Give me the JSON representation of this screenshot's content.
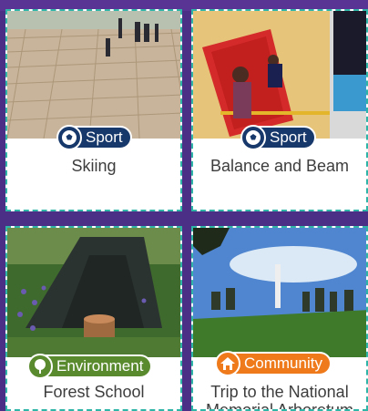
{
  "activities": [
    {
      "title": "Skiing",
      "category": "Sport",
      "category_icon": "football-icon",
      "badge_color": "#17386b"
    },
    {
      "title": "Balance and Beam",
      "category": "Sport",
      "category_icon": "football-icon",
      "badge_color": "#17386b"
    },
    {
      "title": "Forest School",
      "category": "Environment",
      "category_icon": "tree-icon",
      "badge_color": "#5a8a2e"
    },
    {
      "title": "Trip to the National Memorial Arboretum",
      "category": "Community",
      "category_icon": "house-icon",
      "badge_color": "#ee7a1c"
    }
  ]
}
